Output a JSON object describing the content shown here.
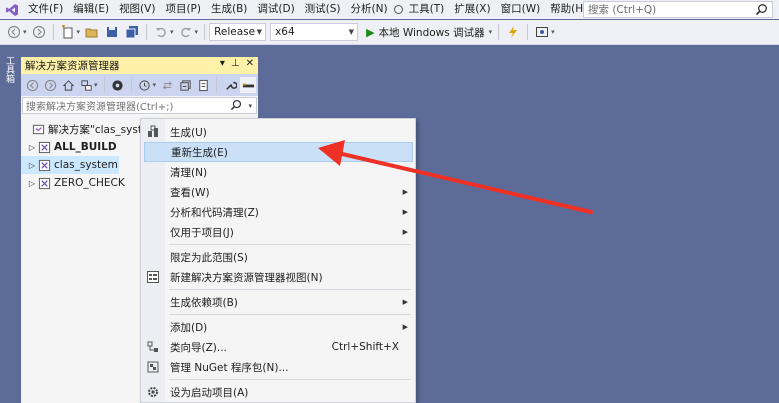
{
  "colors": {
    "accent": "#ee3124",
    "selection": "#cce8ff",
    "title_bar": "#fff1a8",
    "toolbar_blue": "#ccd5f0"
  },
  "menubar": {
    "items": [
      "文件(F)",
      "编辑(E)",
      "视图(V)",
      "项目(P)",
      "生成(B)",
      "调试(D)",
      "测试(S)",
      "分析(N)",
      "工具(T)",
      "扩展(X)",
      "窗口(W)",
      "帮助(H)"
    ],
    "search_placeholder": "搜索 (Ctrl+Q)"
  },
  "toolbar": {
    "configuration": "Release",
    "platform": "x64",
    "run_label": "本地 Windows 调试器"
  },
  "toolbox": {
    "tab_label": "工具箱"
  },
  "solution_explorer": {
    "title": "解决方案资源管理器",
    "title_controls": [
      "▾",
      "⊥",
      "✕"
    ],
    "search_placeholder": "搜索解决方案资源管理器(Ctrl+;)",
    "tree": [
      {
        "label": "解决方案\"clas_system\"",
        "bold": false,
        "expand": ""
      },
      {
        "label": "ALL_BUILD",
        "bold": true,
        "expand": "▷"
      },
      {
        "label": "clas_system",
        "bold": false,
        "expand": "▷"
      },
      {
        "label": "ZERO_CHECK",
        "bold": false,
        "expand": "▷"
      }
    ]
  },
  "context_menu": {
    "build": "生成(U)",
    "rebuild": "重新生成(E)",
    "clean": "清理(N)",
    "view": "查看(W)",
    "analyze": "分析和代码清理(Z)",
    "project_only": "仅用于项目(J)",
    "scope_to_this": "限定为此范围(S)",
    "new_explorer_view": "新建解决方案资源管理器视图(N)",
    "build_dependencies": "生成依赖项(B)",
    "add": "添加(D)",
    "class_wizard": "类向导(Z)...",
    "class_wizard_shortcut": "Ctrl+Shift+X",
    "nuget": "管理 NuGet 程序包(N)...",
    "set_startup": "设为启动项目(A)"
  }
}
